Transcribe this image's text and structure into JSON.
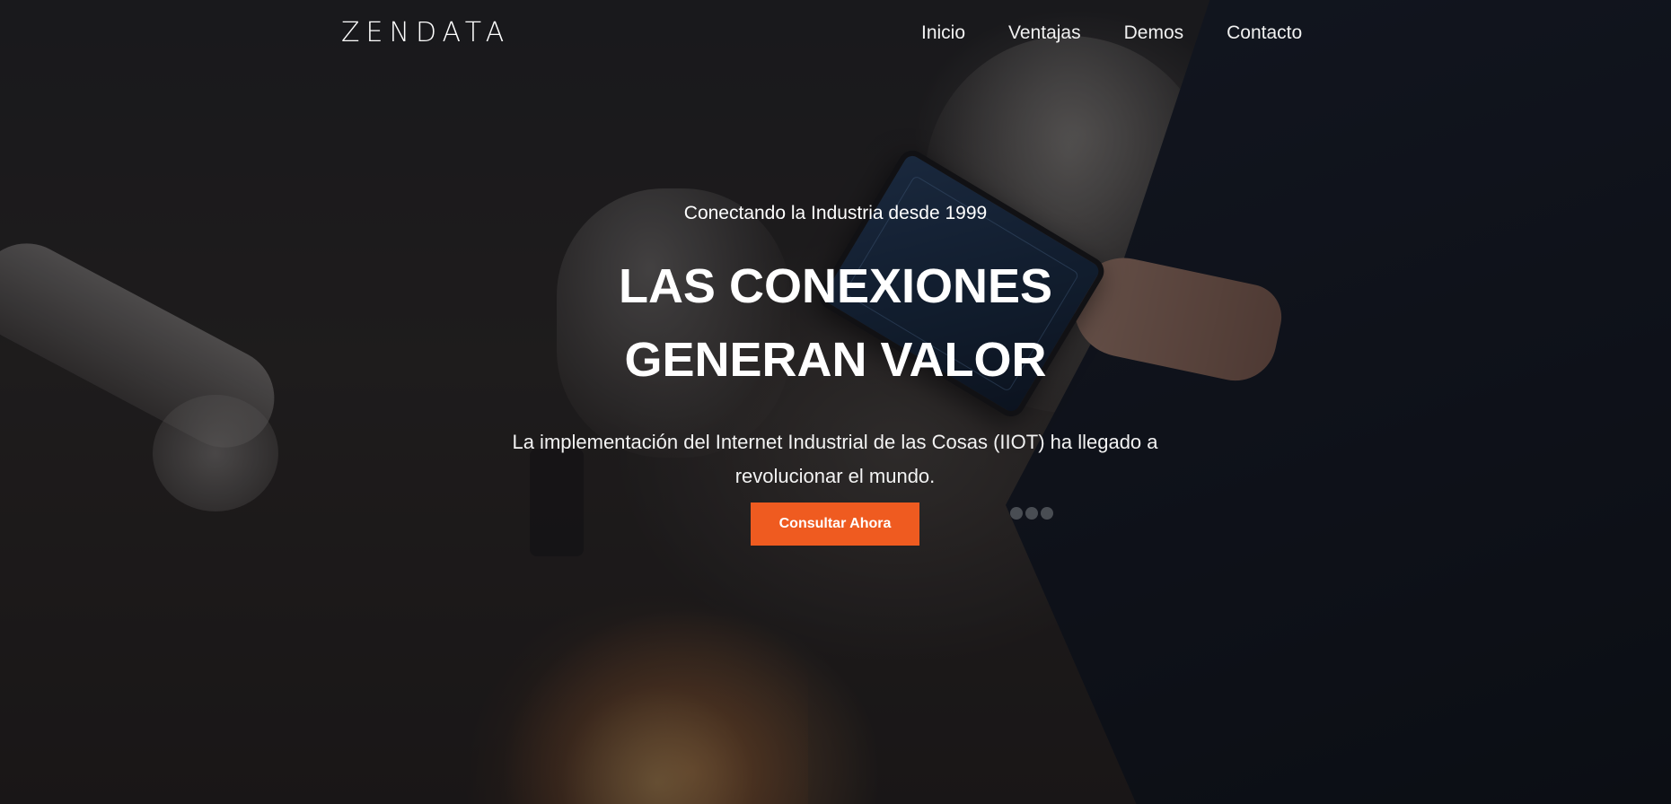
{
  "brand": {
    "logo_text": "ZENDATA"
  },
  "nav": {
    "items": [
      {
        "label": "Inicio"
      },
      {
        "label": "Ventajas"
      },
      {
        "label": "Demos"
      },
      {
        "label": "Contacto"
      }
    ]
  },
  "hero": {
    "tagline": "Conectando la Industria desde 1999",
    "headline_line1": "LAS CONEXIONES",
    "headline_line2": "GENERAN VALOR",
    "subtext": "La implementación del Internet Industrial de las Cosas (IIOT) ha llegado a revolucionar el mundo.",
    "cta_label": "Consultar Ahora"
  },
  "colors": {
    "accent": "#ef5b20",
    "text": "#ffffff"
  }
}
